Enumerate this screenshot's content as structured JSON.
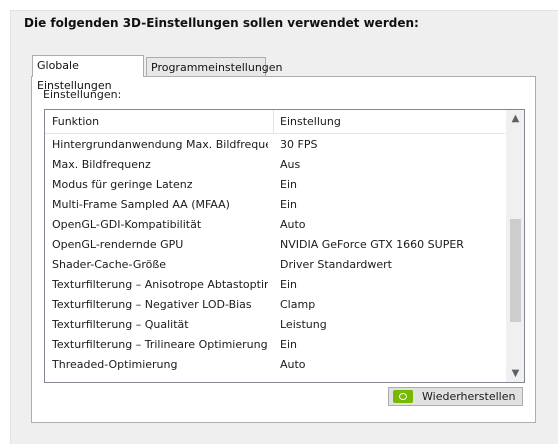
{
  "heading": "Die folgenden 3D-Einstellungen sollen verwendet werden:",
  "tabs": {
    "global": "Globale Einstellungen",
    "program": "Programmeinstellungen"
  },
  "settings_label": "Einstellungen:",
  "columns": {
    "function": "Funktion",
    "setting": "Einstellung"
  },
  "rows": [
    {
      "function": "Hintergrundanwendung Max. Bildfrequenz",
      "setting": "30 FPS"
    },
    {
      "function": "Max. Bildfrequenz",
      "setting": "Aus"
    },
    {
      "function": "Modus für geringe Latenz",
      "setting": "Ein"
    },
    {
      "function": "Multi-Frame Sampled AA (MFAA)",
      "setting": "Ein"
    },
    {
      "function": "OpenGL-GDI-Kompatibilität",
      "setting": "Auto"
    },
    {
      "function": "OpenGL-rendernde GPU",
      "setting": "NVIDIA GeForce GTX 1660 SUPER"
    },
    {
      "function": "Shader-Cache-Größe",
      "setting": "Driver Standardwert"
    },
    {
      "function": "Texturfilterung – Anisotrope Abtastoptimi...",
      "setting": "Ein"
    },
    {
      "function": "Texturfilterung – Negativer LOD-Bias",
      "setting": "Clamp"
    },
    {
      "function": "Texturfilterung – Qualität",
      "setting": "Leistung"
    },
    {
      "function": "Texturfilterung – Trilineare Optimierung",
      "setting": "Ein"
    },
    {
      "function": "Threaded-Optimierung",
      "setting": "Auto"
    }
  ],
  "restore_button": "Wiederherstellen",
  "icons": {
    "scroll_up": "chevron-up-icon",
    "scroll_down": "chevron-down-icon",
    "restore": "nvidia-logo-icon"
  },
  "colors": {
    "nvidia_green": "#76b900"
  }
}
